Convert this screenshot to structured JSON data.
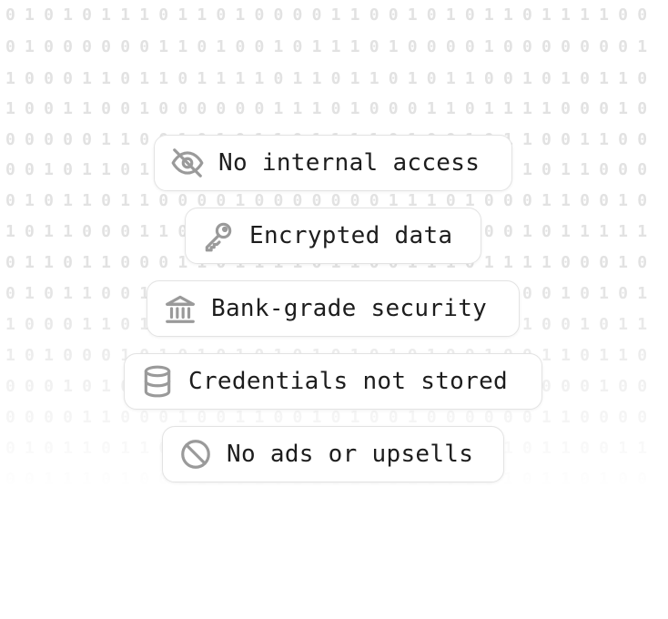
{
  "background": {
    "binary_rows": [
      "0101011101101000011001010110111100",
      "0100000011010010111010000100000001",
      "1000110110111101101101011001010110",
      "1001100100000011101000110111100010",
      "0000011001010110111101001011001100",
      "0010110101101011011010101101011000",
      "0101101100001000000011101000110010",
      "1011000110110101001101011001011111",
      "0110110001101111011001110111100010",
      "0101100110101011011011010100010101",
      "1000110101011011010101010101001011",
      "1010001010101010101010100100110110",
      "0001010101101011001010011001000100",
      "0000110001001100101001000000110000",
      "0101101101011011010101011010110011",
      "0011101001100101101101001010110100"
    ]
  },
  "badges": [
    {
      "icon": "eye-off-icon",
      "label": "No internal access"
    },
    {
      "icon": "key-icon",
      "label": "Encrypted data"
    },
    {
      "icon": "bank-icon",
      "label": "Bank-grade security"
    },
    {
      "icon": "database-icon",
      "label": "Credentials not stored"
    },
    {
      "icon": "ban-icon",
      "label": "No ads or upsells"
    }
  ],
  "colors": {
    "badge_border": "#e3e3e3",
    "icon_stroke": "#9a9a9a",
    "label_text": "#1d1d1d",
    "binary_digits": "#e2e2e2"
  }
}
